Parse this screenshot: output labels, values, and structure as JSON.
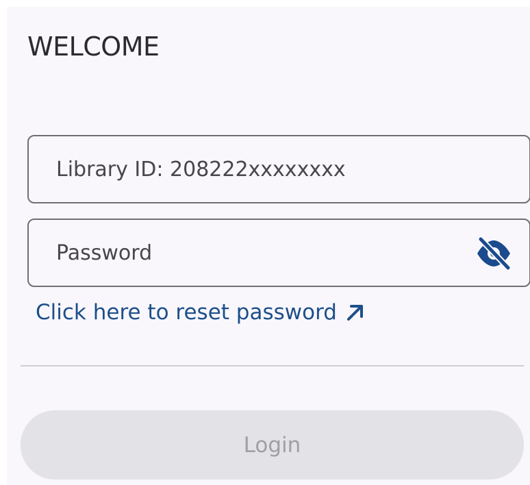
{
  "header": {
    "title": "WELCOME"
  },
  "form": {
    "library_id": {
      "placeholder": "Library ID: 208222xxxxxxxx",
      "value": ""
    },
    "password": {
      "placeholder": "Password",
      "value": "",
      "visibility_icon": "eye-off-icon"
    },
    "reset_link_label": "Click here to reset password",
    "reset_link_icon": "arrow-up-right-icon",
    "login_label": "Login",
    "login_disabled": true
  },
  "colors": {
    "background": "#f9f7fc",
    "link": "#1d4f8a",
    "icon": "#1a4b8c",
    "button_disabled_bg": "#e3e2e6",
    "button_disabled_text": "#a09fa4"
  }
}
